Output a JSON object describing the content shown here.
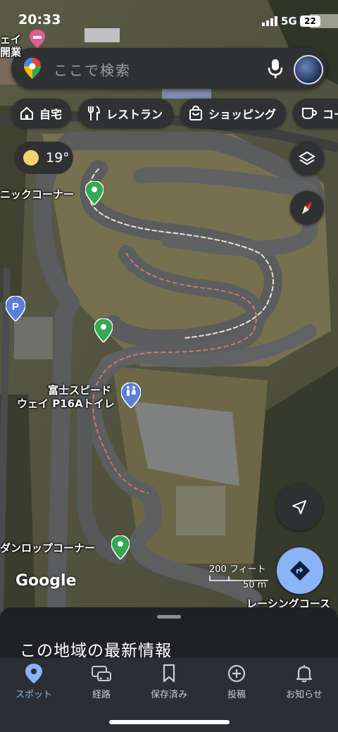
{
  "status": {
    "time": "20:33",
    "network": "5G",
    "battery": "22"
  },
  "search": {
    "placeholder": "ここで検索"
  },
  "chips": [
    {
      "label": "自宅",
      "icon": "home-icon"
    },
    {
      "label": "レストラン",
      "icon": "restaurant-icon"
    },
    {
      "label": "ショッピング",
      "icon": "shopping-bag-icon"
    },
    {
      "label": "コー",
      "icon": "coffee-icon"
    }
  ],
  "weather": {
    "temp": "19°"
  },
  "map_labels": {
    "top_left_1": "ェイ",
    "top_left_2": "開業",
    "corner_1": "ニックコーナー",
    "toilet_1": "富士スピード",
    "toilet_2": "ウェイ P16Aトイレ",
    "dunlop": "ダンロップコーナー",
    "course": "レーシングコース",
    "parking": "P"
  },
  "scale": {
    "feet": "200 フィート",
    "meters": "50 m"
  },
  "brand": "Google",
  "sheet": {
    "title": "この地域の最新情報"
  },
  "tabs": [
    {
      "label": "スポット",
      "icon": "explore-pin-icon",
      "active": true
    },
    {
      "label": "経路",
      "icon": "commute-car-icon",
      "active": false
    },
    {
      "label": "保存済み",
      "icon": "bookmark-icon",
      "active": false
    },
    {
      "label": "投稿",
      "icon": "add-circle-icon",
      "active": false
    },
    {
      "label": "お知らせ",
      "icon": "bell-icon",
      "active": false
    }
  ],
  "colors": {
    "accent": "#8ab4f8",
    "pin_green": "#34a853",
    "toilet_blue": "#5b7fd6",
    "directions_blue": "#8ab4f8"
  }
}
